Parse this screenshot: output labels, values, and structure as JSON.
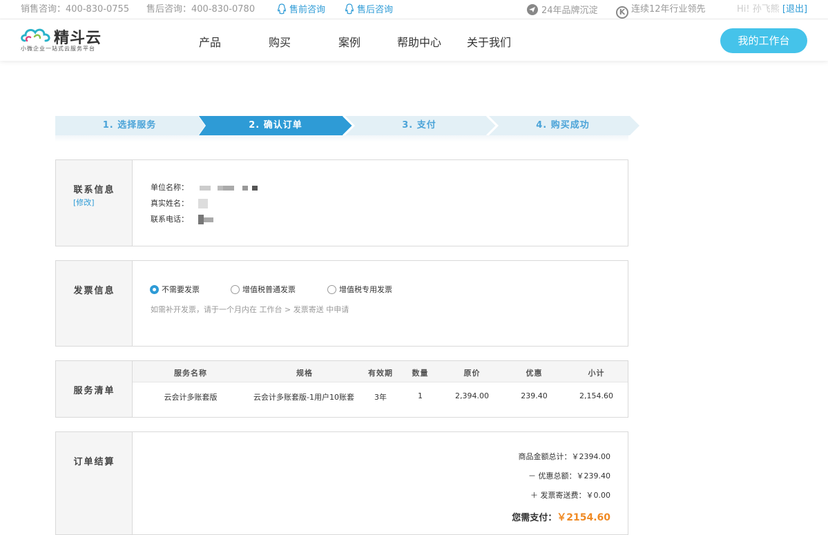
{
  "topbar": {
    "sales_phone": "销售咨询：400-830-0755",
    "service_phone": "售后咨询：400-830-0780",
    "presale_qq": "售前咨询",
    "aftersale_qq": "售后咨询",
    "brand_years": "24年品牌沉淀",
    "industry_lead": "连续12年行业领先",
    "greeting": "Hi! 孙飞熊",
    "logout": "[退出]"
  },
  "header": {
    "logo_text": "精斗云",
    "logo_slogan": "小微企业一站式云服务平台",
    "nav": [
      "产品",
      "购买",
      "案例",
      "帮助中心",
      "关于我们"
    ],
    "workbench_button": "我的工作台"
  },
  "steps": [
    "1. 选择服务",
    "2. 确认订单",
    "3. 支付",
    "4. 购买成功"
  ],
  "active_step": 1,
  "colors": {
    "accent": "#2e9bd6",
    "step_inactive": "#e3f0f6",
    "price": "#f08a24",
    "button": "#45c3ea"
  },
  "contact": {
    "title": "联系信息",
    "edit": "[修改]",
    "company_label": "单位名称：",
    "name_label": "真实姓名：",
    "phone_label": "联系电话："
  },
  "invoice": {
    "title": "发票信息",
    "options": [
      "不需要发票",
      "增值税普通发票",
      "增值税专用发票"
    ],
    "selected": 0,
    "note": "如需补开发票，请于一个月内在 工作台 > 发票寄送 中申请"
  },
  "services": {
    "title": "服务清单",
    "columns": [
      "服务名称",
      "规格",
      "有效期",
      "数量",
      "原价",
      "优惠",
      "小计"
    ],
    "rows": [
      [
        "云会计多账套版",
        "云会计多账套版-1用户10账套",
        "3年",
        "1",
        "2,394.00",
        "239.40",
        "2,154.60"
      ]
    ]
  },
  "summary": {
    "title": "订单结算",
    "goods_total": "商品金额总计：￥2394.00",
    "discount_total": "－ 优惠总额：￥239.40",
    "invoice_fee": "＋ 发票寄送费：￥0.00",
    "pay_label": "您需支付：",
    "pay_amount": "￥2154.60"
  }
}
